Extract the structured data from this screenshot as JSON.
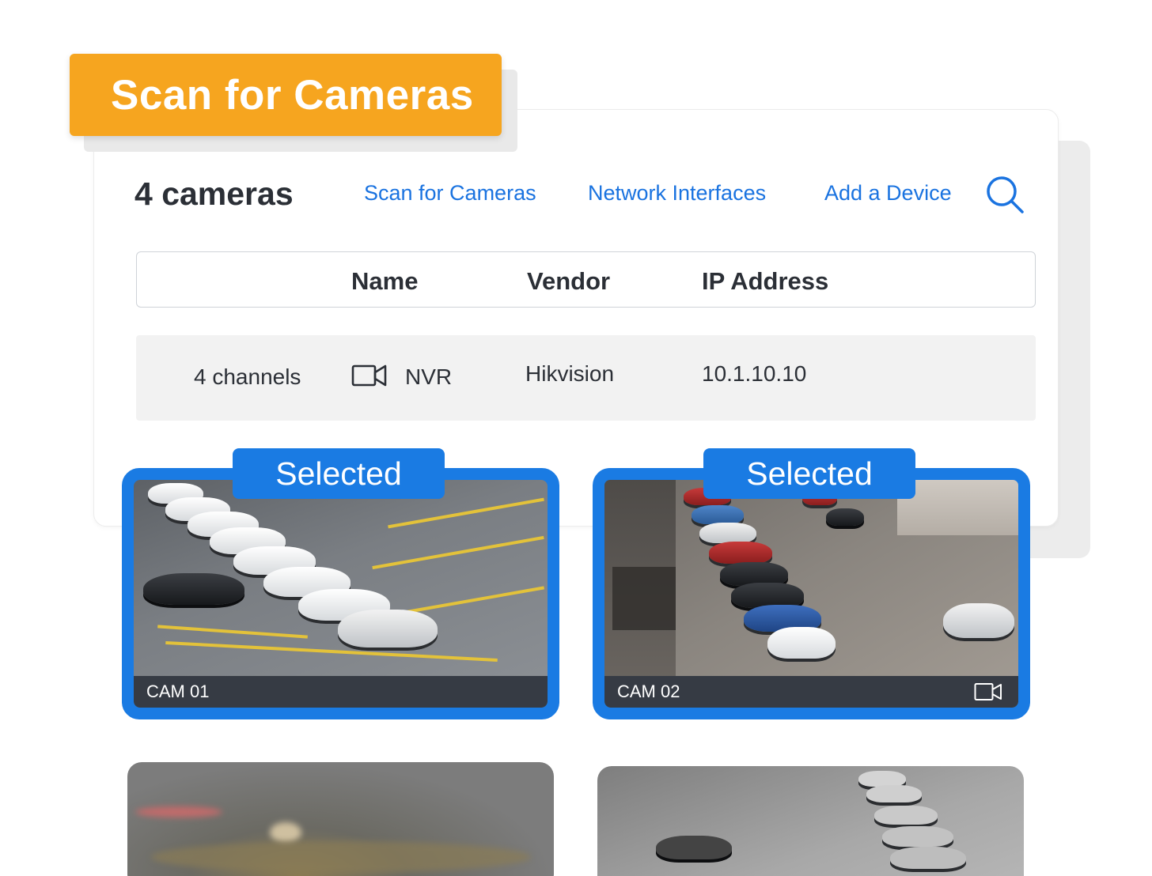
{
  "banner": {
    "title": "Scan for Cameras"
  },
  "header": {
    "count_title": "4 cameras",
    "links": [
      "Scan for Cameras",
      "Network Interfaces",
      "Add a Device"
    ],
    "search_icon": "search-icon"
  },
  "table": {
    "columns": [
      "Name",
      "Vendor",
      "IP Address"
    ],
    "rows": [
      {
        "channels": "4 channels",
        "icon": "video-camera-icon",
        "name": "NVR",
        "vendor": "Hikvision",
        "ip": "10.1.10.10"
      }
    ]
  },
  "cameras": [
    {
      "label": "CAM 01",
      "badge": "Selected",
      "selected": true
    },
    {
      "label": "CAM 02",
      "badge": "Selected",
      "selected": true,
      "icon": "video-camera-icon"
    }
  ],
  "colors": {
    "accent": "#1a7be3",
    "link": "#1a73e0",
    "banner": "#f6a51f",
    "text": "#2b2f36"
  }
}
